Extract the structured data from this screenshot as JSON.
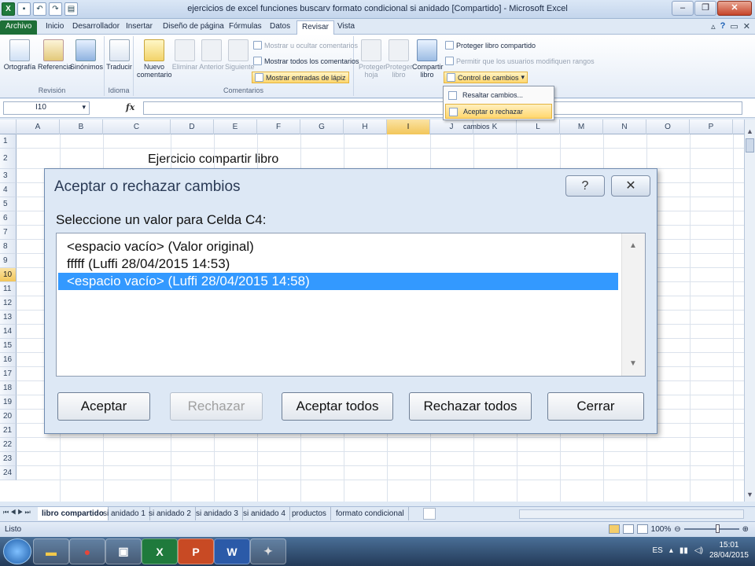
{
  "window": {
    "title": "ejercicios de excel funciones buscarv formato condicional si anidado  [Compartido]  -  Microsoft Excel"
  },
  "menu_tabs": [
    "Archivo",
    "Inicio",
    "Desarrollador",
    "Insertar",
    "Diseño de página",
    "Fórmulas",
    "Datos",
    "Revisar",
    "Vista"
  ],
  "ribbon": {
    "revision": {
      "label": "Revisión",
      "ortografia": "Ortografía",
      "referencia": "Referencia",
      "sinonimos": "Sinónimos"
    },
    "idioma": {
      "label": "Idioma",
      "traducir": "Traducir"
    },
    "comentarios": {
      "label": "Comentarios",
      "nuevo": "Nuevo comentario",
      "eliminar": "Eliminar",
      "anterior": "Anterior",
      "siguiente": "Siguiente",
      "mostrar_ocultar": "Mostrar u ocultar comentarios",
      "mostrar_todos": "Mostrar todos los comentarios",
      "mostrar_entradas": "Mostrar entradas de lápiz"
    },
    "cambios": {
      "proteger_hoja": "Proteger hoja",
      "proteger_libro": "Proteger libro",
      "compartir_libro": "Compartir libro",
      "proteger_compartido": "Proteger libro compartido",
      "permitir": "Permitir que los usuarios modifiquen rangos",
      "control": "Control de cambios"
    }
  },
  "dropdown": {
    "items": [
      "Resaltar cambios...",
      "Aceptar o rechazar cambios"
    ]
  },
  "formula_bar": {
    "name_box": "I10",
    "fx": "fx",
    "value": ""
  },
  "columns": [
    "A",
    "B",
    "C",
    "D",
    "E",
    "F",
    "G",
    "H",
    "I",
    "J",
    "K",
    "L",
    "M",
    "N",
    "O",
    "P"
  ],
  "rows": [
    "1",
    "2",
    "3",
    "4",
    "5",
    "6",
    "7",
    "8",
    "9",
    "10",
    "11",
    "12",
    "13",
    "14",
    "15",
    "16",
    "17",
    "18",
    "19",
    "20",
    "21",
    "22",
    "23",
    "24"
  ],
  "cells": {
    "C2": "Ejercicio compartir libro"
  },
  "dialog": {
    "title": "Aceptar o rechazar cambios",
    "help": "?",
    "close": "✕",
    "prompt": "Seleccione un valor para Celda C4:",
    "options": [
      "<espacio vacío>  (Valor original)",
      "fffff  (Luffi 28/04/2015 14:53)",
      "<espacio vacío>  (Luffi 28/04/2015 14:58)"
    ],
    "buttons": {
      "aceptar": "Aceptar",
      "rechazar": "Rechazar",
      "aceptar_todos": "Aceptar todos",
      "rechazar_todos": "Rechazar todos",
      "cerrar": "Cerrar"
    }
  },
  "sheet_tabs": [
    "libro compartido",
    "si anidado 1",
    "si anidado 2",
    "si anidado 3",
    "si anidado 4",
    "productos",
    "formato condicional"
  ],
  "status": {
    "text": "Listo",
    "zoom": "100%"
  },
  "tray": {
    "lang": "ES",
    "time": "15:01",
    "date": "28/04/2015"
  }
}
